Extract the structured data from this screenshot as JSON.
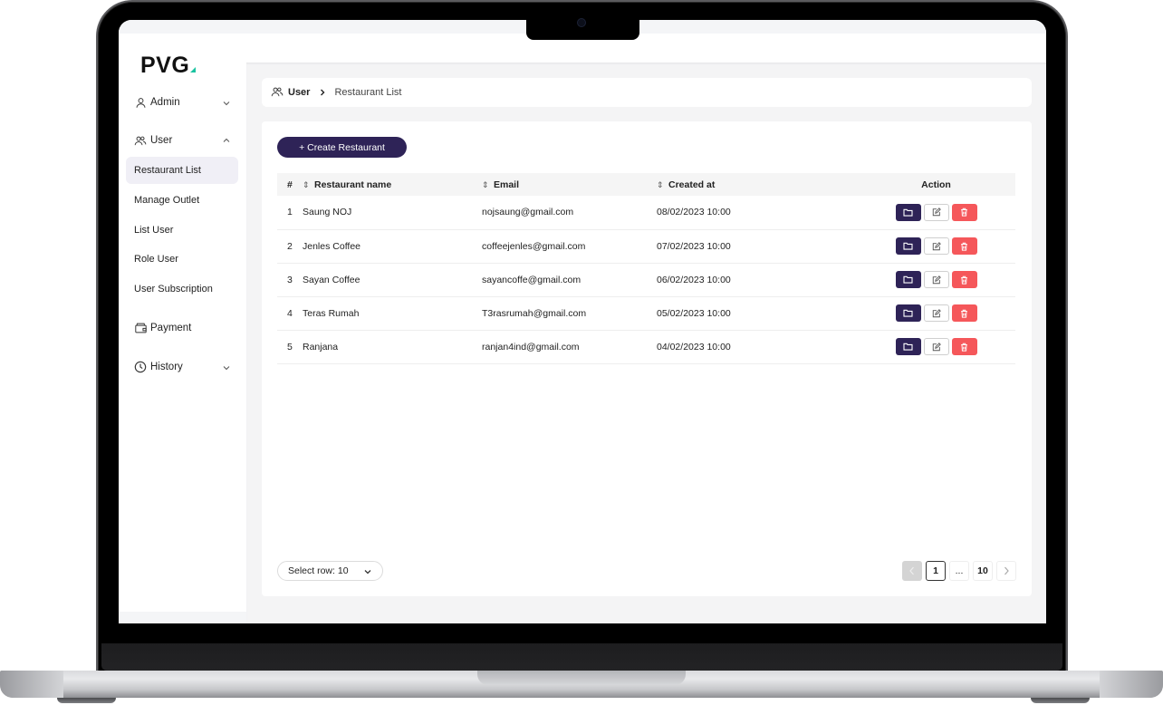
{
  "app": {
    "logo": "PVG",
    "accent_color": "#2e2357",
    "logo_accent_color": "#19c3a0",
    "danger_color": "#f5575a"
  },
  "sidebar": {
    "groups": [
      {
        "label": "Admin",
        "icon": "user-icon",
        "expanded": false
      },
      {
        "label": "User",
        "icon": "users-icon",
        "expanded": true,
        "items": [
          {
            "label": "Restaurant List",
            "active": true
          },
          {
            "label": "Manage Outlet",
            "active": false
          },
          {
            "label": "List User",
            "active": false
          },
          {
            "label": "Role User",
            "active": false
          },
          {
            "label": "User Subscription",
            "active": false
          }
        ]
      },
      {
        "label": "Payment",
        "icon": "wallet-icon"
      },
      {
        "label": "History",
        "icon": "clock-icon",
        "expanded": false
      }
    ]
  },
  "breadcrumb": {
    "parent": "User",
    "current": "Restaurant List"
  },
  "toolbar": {
    "create_label": "+ Create Restaurant"
  },
  "table": {
    "columns": [
      "#",
      "Restaurant name",
      "Email",
      "Created at",
      "Action"
    ],
    "rows": [
      {
        "num": "1",
        "name": "Saung NOJ",
        "email": "nojsaung@gmail.com",
        "created": "08/02/2023 10:00"
      },
      {
        "num": "2",
        "name": "Jenles Coffee",
        "email": "coffeejenles@gmail.com",
        "created": "07/02/2023 10:00"
      },
      {
        "num": "3",
        "name": "Sayan Coffee",
        "email": "sayancoffe@gmail.com",
        "created": "06/02/2023 10:00"
      },
      {
        "num": "4",
        "name": "Teras Rumah",
        "email": "T3rasrumah@gmail.com",
        "created": "05/02/2023 10:00"
      },
      {
        "num": "5",
        "name": "Ranjana",
        "email": "ranjan4ind@gmail.com",
        "created": "04/02/2023 10:00"
      }
    ],
    "actions": [
      "view-folder-icon",
      "edit-icon",
      "delete-trash-icon"
    ]
  },
  "footer": {
    "select_row_label": "Select row: 10",
    "pagination": {
      "current": "1",
      "ellipsis": "...",
      "last": "10"
    }
  }
}
